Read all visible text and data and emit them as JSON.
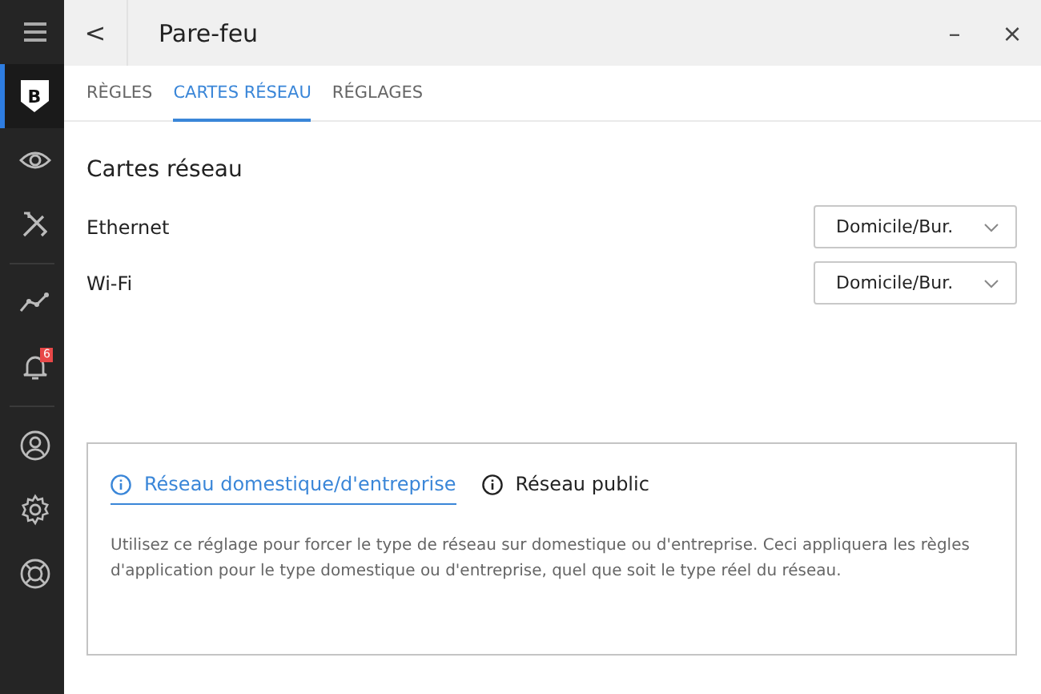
{
  "sidebar": {
    "items": [
      {
        "kind": "menu",
        "selected": false
      },
      {
        "kind": "shield",
        "selected": true,
        "label": "B"
      },
      {
        "kind": "eye",
        "selected": false
      },
      {
        "kind": "tools",
        "selected": false
      },
      {
        "kind": "separator"
      },
      {
        "kind": "chart",
        "selected": false
      },
      {
        "kind": "bell",
        "selected": false,
        "badge": "6"
      },
      {
        "kind": "separator"
      },
      {
        "kind": "user",
        "selected": false
      },
      {
        "kind": "gear",
        "selected": false
      },
      {
        "kind": "lifebuoy",
        "selected": false
      }
    ]
  },
  "header": {
    "back": "<",
    "title": "Pare-feu",
    "minimize": "–",
    "close": "×"
  },
  "tabs": [
    {
      "label": "RÈGLES",
      "selected": false
    },
    {
      "label": "CARTES RÉSEAU",
      "selected": true
    },
    {
      "label": "RÉGLAGES",
      "selected": false
    }
  ],
  "section_title": "Cartes réseau",
  "adapters": [
    {
      "name": "Ethernet",
      "value": "Domicile/Bur."
    },
    {
      "name": "Wi-Fi",
      "value": "Domicile/Bur."
    }
  ],
  "info": {
    "tabs": [
      {
        "label": "Réseau domestique/d'entreprise",
        "selected": true
      },
      {
        "label": "Réseau public",
        "selected": false
      }
    ],
    "description": "Utilisez ce réglage pour forcer le type de réseau sur domestique ou d'entreprise. Ceci appliquera les règles d'application pour le type domestique ou d'entreprise, quel que soit le type réel du réseau."
  }
}
